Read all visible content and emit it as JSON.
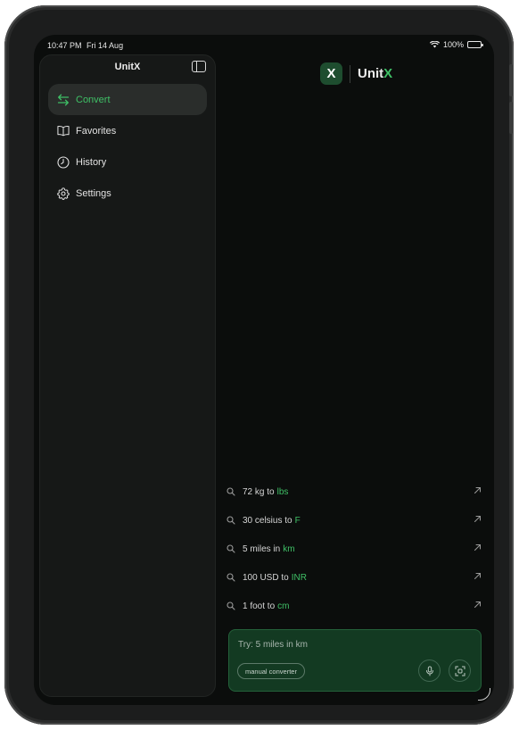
{
  "status": {
    "time": "10:47 PM",
    "date": "Fri 14 Aug",
    "battery": "100%"
  },
  "sidebar": {
    "title": "UnitX",
    "items": [
      {
        "label": "Convert",
        "icon": "arrows-swap-icon",
        "active": true
      },
      {
        "label": "Favorites",
        "icon": "book-icon",
        "active": false
      },
      {
        "label": "History",
        "icon": "clock-icon",
        "active": false
      },
      {
        "label": "Settings",
        "icon": "gear-icon",
        "active": false
      }
    ]
  },
  "header": {
    "logo_mark": "X",
    "brand_main": "Unit",
    "brand_accent": "X"
  },
  "suggestions": [
    {
      "prefix": "72 kg to",
      "unit": "lbs"
    },
    {
      "prefix": "30 celsius to",
      "unit": "F"
    },
    {
      "prefix": "5 miles in",
      "unit": "km"
    },
    {
      "prefix": "100 USD to",
      "unit": "INR"
    },
    {
      "prefix": "1 foot to",
      "unit": "cm"
    }
  ],
  "input": {
    "placeholder": "Try: 5 miles in km",
    "chip_label": "manual converter"
  },
  "colors": {
    "accent": "#3fc066",
    "card_bg": "#133a22",
    "screen_bg": "#0b0d0c"
  }
}
